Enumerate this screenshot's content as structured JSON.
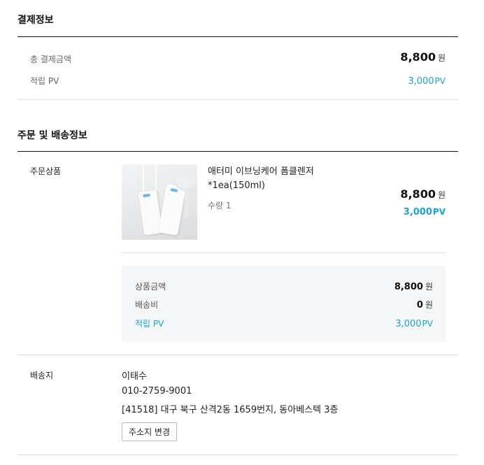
{
  "payment": {
    "title": "결제정보",
    "total_label": "총 결제금액",
    "total_value": "8,800",
    "total_unit": "원",
    "pv_label": "적립 PV",
    "pv_value": "3,000",
    "pv_unit": "PV"
  },
  "order": {
    "title": "주문 및 배송정보",
    "product_label": "주문상품",
    "product": {
      "name_line1": "애터미 이브닝케어 폼클렌저",
      "name_line2": "*1ea(150ml)",
      "quantity": "수량 1",
      "price": "8,800",
      "price_unit": "원",
      "pv": "3,000",
      "pv_unit": "PV",
      "image_alt": "product-image"
    },
    "summary": {
      "items": [
        {
          "label": "상품금액",
          "value": "8,800",
          "unit": "원"
        },
        {
          "label": "배송비",
          "value": "0",
          "unit": "원"
        },
        {
          "label": "적립 PV",
          "value": "3,000",
          "unit": "PV"
        }
      ]
    },
    "shipping_label": "배송지",
    "shipping": {
      "name": "이태수",
      "phone": "010-2759-9001",
      "address": "[41518] 대구 북구 산격2동 1659번지, 동아베스텍 3층",
      "change_button": "주소지 변경"
    }
  },
  "colors": {
    "accent_pv": "#1aa3d6",
    "summary_bg": "#f5f6f8"
  }
}
